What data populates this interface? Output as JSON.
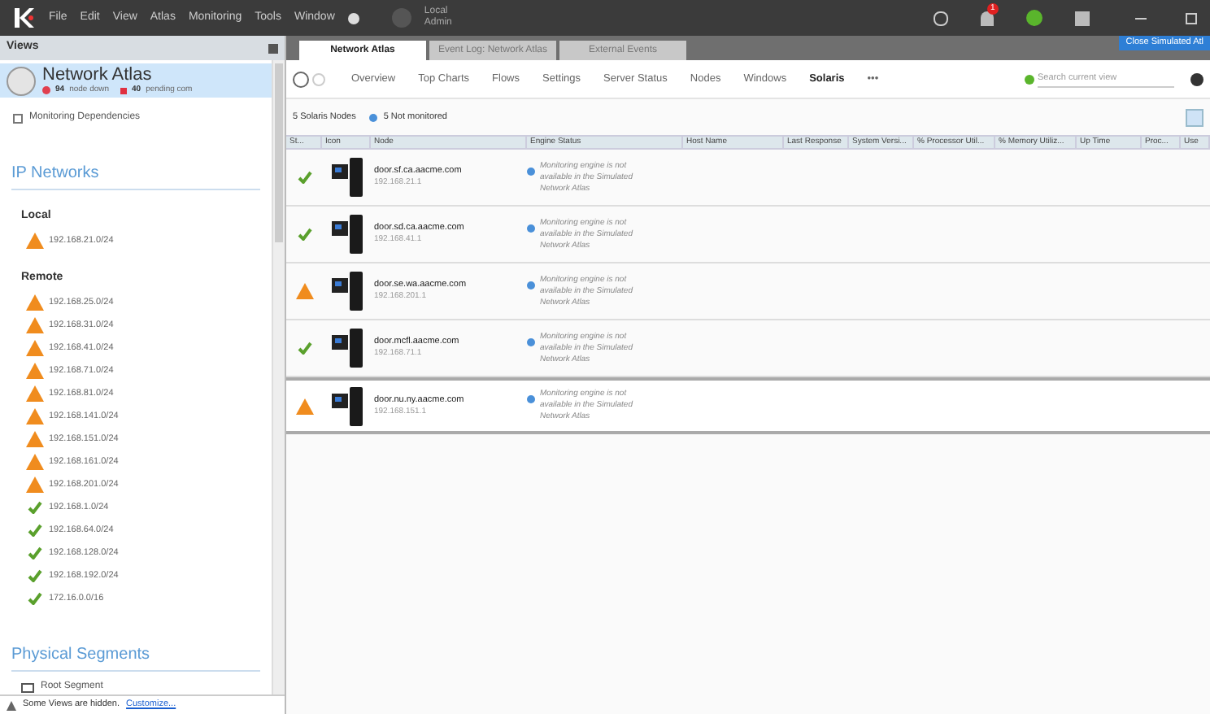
{
  "menu": [
    "File",
    "Edit",
    "View",
    "Atlas",
    "Monitoring",
    "Tools",
    "Window"
  ],
  "user": {
    "name": "Local",
    "role": "Admin"
  },
  "notifications": {
    "badge": "1"
  },
  "close_button": "Close Simulated Atl",
  "views": {
    "title": "Views",
    "atlas": {
      "name": "Network Atlas",
      "down": "94",
      "down_label": "node down",
      "pending": "40",
      "pending_label": "pending com"
    },
    "dependencies": "Monitoring Dependencies",
    "ip_heading": "IP Networks",
    "groups": [
      {
        "label": "Local",
        "items": [
          {
            "name": "192.168.21.0/24",
            "kind": "warning"
          }
        ]
      },
      {
        "label": "Remote",
        "items": [
          {
            "name": "192.168.25.0/24",
            "kind": "warning"
          },
          {
            "name": "192.168.31.0/24",
            "kind": "warning"
          },
          {
            "name": "192.168.41.0/24",
            "kind": "warning"
          },
          {
            "name": "192.168.71.0/24",
            "kind": "warning"
          },
          {
            "name": "192.168.81.0/24",
            "kind": "warning"
          },
          {
            "name": "192.168.141.0/24",
            "kind": "warning"
          },
          {
            "name": "192.168.151.0/24",
            "kind": "warning"
          },
          {
            "name": "192.168.161.0/24",
            "kind": "warning"
          },
          {
            "name": "192.168.201.0/24",
            "kind": "warning"
          },
          {
            "name": "192.168.1.0/24",
            "kind": "ok"
          },
          {
            "name": "192.168.64.0/24",
            "kind": "ok"
          },
          {
            "name": "192.168.128.0/24",
            "kind": "ok"
          },
          {
            "name": "192.168.192.0/24",
            "kind": "ok"
          },
          {
            "name": "172.16.0.0/16",
            "kind": "ok"
          }
        ]
      }
    ],
    "physical_heading": "Physical Segments",
    "segment": "Root Segment",
    "footer": {
      "text": "Some Views are hidden.",
      "link": "Customize..."
    }
  },
  "tabs": [
    {
      "label": "Network Atlas",
      "selected": true
    },
    {
      "label": "Event Log: Network Atlas",
      "selected": false
    },
    {
      "label": "External Events",
      "selected": false
    }
  ],
  "toolbar": [
    {
      "label": "Overview",
      "selected": false
    },
    {
      "label": "Top Charts",
      "selected": false
    },
    {
      "label": "Flows",
      "selected": false
    },
    {
      "label": "Settings",
      "selected": false
    },
    {
      "label": "Server Status",
      "selected": false
    },
    {
      "label": "Nodes",
      "selected": false
    },
    {
      "label": "Windows",
      "selected": false
    },
    {
      "label": "Solaris",
      "selected": true
    },
    {
      "label": "•••",
      "selected": false
    }
  ],
  "search": {
    "placeholder": "Search current view"
  },
  "summary": {
    "nodes": "5 Solaris Nodes",
    "not_monitored": "5 Not monitored"
  },
  "table": {
    "columns": [
      "St...",
      "Icon",
      "Node",
      "Engine Status",
      "Host Name",
      "Last Response",
      "System Versi...",
      "% Processor Util...",
      "% Memory Utiliz...",
      "Up Time",
      "Proc...",
      "Use"
    ],
    "rows": [
      {
        "kind": "ok",
        "node": "door.sf.ca.aacme.com",
        "ip": "192.168.21.1",
        "engine": "Monitoring engine is not available in the Simulated Network Atlas",
        "selected": false
      },
      {
        "kind": "ok",
        "node": "door.sd.ca.aacme.com",
        "ip": "192.168.41.1",
        "engine": "Monitoring engine is not available in the Simulated Network Atlas",
        "selected": false
      },
      {
        "kind": "warning",
        "node": "door.se.wa.aacme.com",
        "ip": "192.168.201.1",
        "engine": "Monitoring engine is not available in the Simulated Network Atlas",
        "selected": false
      },
      {
        "kind": "ok",
        "node": "door.mcfl.aacme.com",
        "ip": "192.168.71.1",
        "engine": "Monitoring engine is not available in the Simulated Network Atlas",
        "selected": false
      },
      {
        "kind": "warning",
        "node": "door.nu.ny.aacme.com",
        "ip": "192.168.151.1",
        "engine": "Monitoring engine is not available in the Simulated Network Atlas",
        "selected": true
      }
    ]
  }
}
